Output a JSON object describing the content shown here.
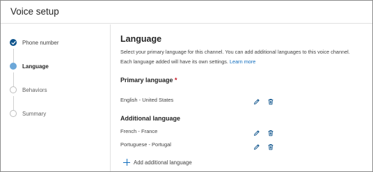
{
  "header": {
    "title": "Voice setup"
  },
  "steps": [
    {
      "label": "Phone number",
      "state": "done"
    },
    {
      "label": "Language",
      "state": "current"
    },
    {
      "label": "Behaviors",
      "state": "todo"
    },
    {
      "label": "Summary",
      "state": "todo"
    }
  ],
  "main": {
    "title": "Language",
    "description_line1": "Select your primary language for this channel. You can add additional languages to this voice channel.",
    "description_line2": "Each language added will have its own settings.",
    "learn_more": "Learn more",
    "primary": {
      "heading": "Primary language",
      "required_mark": "*",
      "value": "English - United States"
    },
    "additional": {
      "heading": "Additional language",
      "items": [
        "French - France",
        "Portuguese - Portugal"
      ]
    },
    "add_label": "Add additional language"
  },
  "colors": {
    "accent": "#0f548c",
    "link": "#0f6cbd",
    "current_step": "#6ca7d8",
    "required": "#c50f1f"
  },
  "icons": {
    "edit": "pencil-icon",
    "delete": "trash-icon",
    "add": "plus-icon",
    "done": "checkmark-icon"
  }
}
